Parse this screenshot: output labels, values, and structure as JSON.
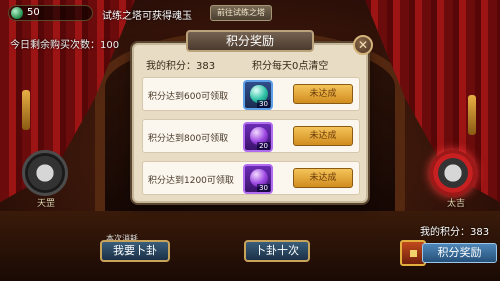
{
  "topbar": {
    "jade_count": "50",
    "tip": "试练之塔可获得魂玉",
    "button_label": "前往试练之塔",
    "buy_count": "今日剩余购买次数：100"
  },
  "stage": {
    "left_taiji_label": "天罡",
    "right_taiji_label": "太吉"
  },
  "modal": {
    "title": "积分奖励",
    "my_score_label": "我的积分：",
    "my_score_value": "383",
    "reset_note": "积分每天0点清空",
    "rows": [
      {
        "text": "积分达到600可领取",
        "item_icon": "cyan-orb-icon",
        "item_qty": "30",
        "status": "未达成"
      },
      {
        "text": "积分达到800可领取",
        "item_icon": "purple-orb-icon",
        "item_qty": "20",
        "status": "未达成"
      },
      {
        "text": "积分达到1200可领取",
        "item_icon": "purple-orb-icon",
        "item_qty": "30",
        "status": "未达成"
      }
    ],
    "close_icon": "close-icon"
  },
  "bottom": {
    "left_small_text": "本次消耗",
    "left_button": "我要卜卦",
    "center_button": "卜卦十次",
    "right_score": "我的积分：383",
    "reward_button": "积分奖励"
  },
  "colors": {
    "modal_bg": "#e9dcc4",
    "status_button": "#e6a83a",
    "curtain_red": "#9c1414"
  }
}
